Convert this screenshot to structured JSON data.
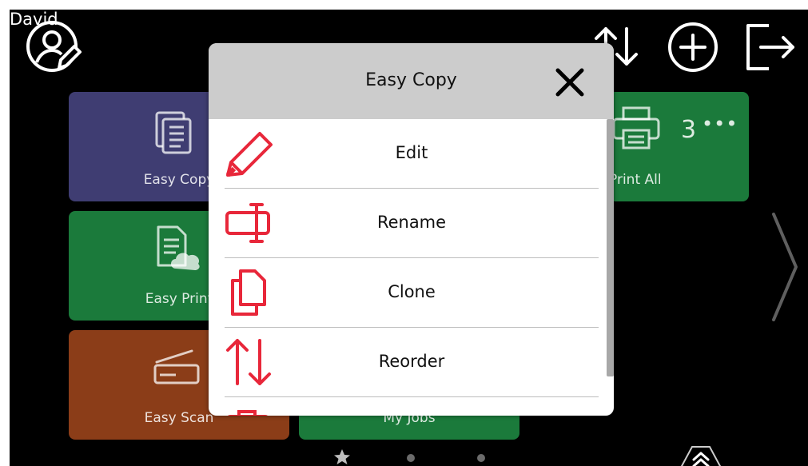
{
  "user": {
    "name": "David",
    "avatar_icon": "user-edit-icon"
  },
  "top_actions": [
    {
      "name": "reorder-icon"
    },
    {
      "name": "add-icon"
    },
    {
      "name": "logout-icon"
    }
  ],
  "tiles": {
    "easy_copy": {
      "label": "Easy Copy",
      "color": "#3f3d72",
      "icon": "document-currency-icon"
    },
    "easy_print": {
      "label": "Easy Print",
      "color": "#1b7a3b",
      "icon": "document-cloud-icon"
    },
    "easy_scan": {
      "label": "Easy Scan",
      "color": "#8b3d18",
      "icon": "scanner-icon"
    },
    "print_all": {
      "label": "Print All",
      "color": "#1b7a3b",
      "count": "3",
      "icon": "printer-icon"
    },
    "my_jobs": {
      "label": "My Jobs",
      "color": "#1b7a3b"
    }
  },
  "modal": {
    "title": "Easy Copy",
    "close_icon": "close-icon",
    "accent": "#e8273a",
    "items": [
      {
        "label": "Edit",
        "icon": "pencil-icon"
      },
      {
        "label": "Rename",
        "icon": "rename-icon"
      },
      {
        "label": "Clone",
        "icon": "clone-icon"
      },
      {
        "label": "Reorder",
        "icon": "reorder-icon"
      },
      {
        "label": "",
        "icon": "toolbox-icon"
      }
    ]
  },
  "pager": {
    "pages": 3,
    "current": 1,
    "next_icon": "chevron-right-icon",
    "expand_icon": "double-chevron-up-icon"
  }
}
